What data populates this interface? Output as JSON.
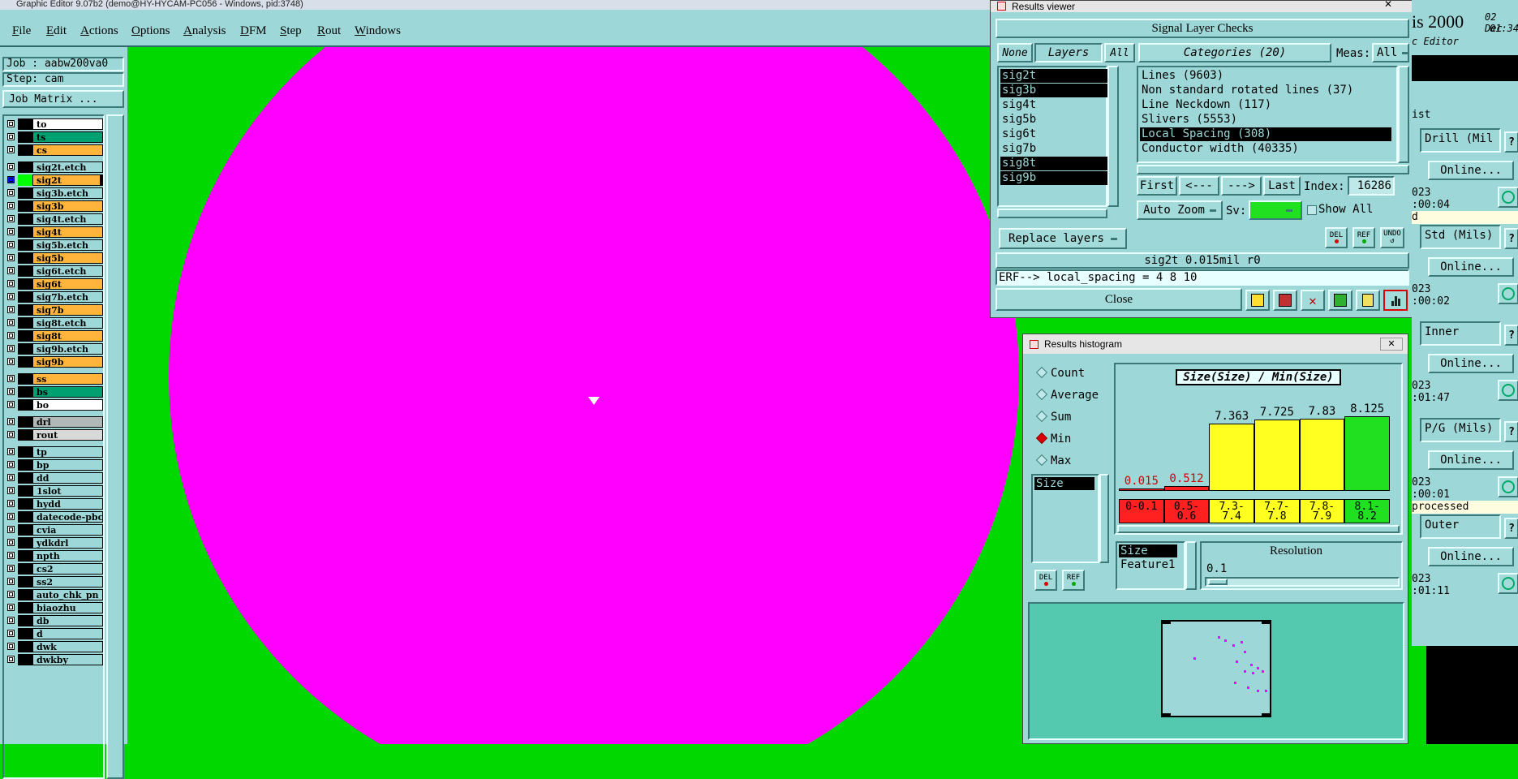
{
  "window_title": "Graphic Editor 9.07b2 (demo@HY-HYCAM-PC056 - Windows, pid:3748)",
  "menu": [
    "File",
    "Edit",
    "Actions",
    "Options",
    "Analysis",
    "DFM",
    "Step",
    "Rout",
    "Windows"
  ],
  "job": {
    "job_label": "Job : aabw200va0",
    "step_label": "Step: cam",
    "matrix_button": "Job Matrix ..."
  },
  "layers": [
    {
      "name": "to",
      "color": "#ffffff"
    },
    {
      "name": "ts",
      "color": "#00a070"
    },
    {
      "name": "cs",
      "color": "#ffb43c"
    },
    {
      "name": "sig2t.etch",
      "color": "#9ed7d7"
    },
    {
      "name": "sig2t",
      "color": "#ffb43c",
      "active": true
    },
    {
      "name": "sig3b.etch",
      "color": "#9ed7d7"
    },
    {
      "name": "sig3b",
      "color": "#ffb43c"
    },
    {
      "name": "sig4t.etch",
      "color": "#9ed7d7"
    },
    {
      "name": "sig4t",
      "color": "#ffb43c"
    },
    {
      "name": "sig5b.etch",
      "color": "#9ed7d7"
    },
    {
      "name": "sig5b",
      "color": "#ffb43c"
    },
    {
      "name": "sig6t.etch",
      "color": "#9ed7d7"
    },
    {
      "name": "sig6t",
      "color": "#ffb43c"
    },
    {
      "name": "sig7b.etch",
      "color": "#9ed7d7"
    },
    {
      "name": "sig7b",
      "color": "#ffb43c"
    },
    {
      "name": "sig8t.etch",
      "color": "#9ed7d7"
    },
    {
      "name": "sig8t",
      "color": "#ffb43c"
    },
    {
      "name": "sig9b.etch",
      "color": "#9ed7d7"
    },
    {
      "name": "sig9b",
      "color": "#ffb43c"
    },
    {
      "name": "ss",
      "color": "#ffb43c"
    },
    {
      "name": "bs",
      "color": "#00a070"
    },
    {
      "name": "bo",
      "color": "#ffffff"
    },
    {
      "name": "drl",
      "color": "#b0b8b8"
    },
    {
      "name": "rout",
      "color": "#d8d8d8"
    },
    {
      "name": "tp",
      "color": "#9ed7d7"
    },
    {
      "name": "bp",
      "color": "#9ed7d7"
    },
    {
      "name": "dd",
      "color": "#9ed7d7"
    },
    {
      "name": "1slot",
      "color": "#9ed7d7"
    },
    {
      "name": "hydd",
      "color": "#9ed7d7"
    },
    {
      "name": "datecode-pbc",
      "color": "#9ed7d7"
    },
    {
      "name": "cvia",
      "color": "#9ed7d7"
    },
    {
      "name": "ydkdrl",
      "color": "#9ed7d7"
    },
    {
      "name": "npth",
      "color": "#9ed7d7"
    },
    {
      "name": "cs2",
      "color": "#9ed7d7"
    },
    {
      "name": "ss2",
      "color": "#9ed7d7"
    },
    {
      "name": "auto_chk_pn",
      "color": "#9ed7d7"
    },
    {
      "name": "biaozhu",
      "color": "#9ed7d7"
    },
    {
      "name": "db",
      "color": "#9ed7d7"
    },
    {
      "name": "d",
      "color": "#9ed7d7"
    },
    {
      "name": "dwk",
      "color": "#9ed7d7"
    },
    {
      "name": "dwkby",
      "color": "#9ed7d7"
    }
  ],
  "results_viewer": {
    "title": "Results viewer",
    "header": "Signal Layer Checks",
    "none_btn": "None",
    "layers_btn": "Layers",
    "all_btn": "All",
    "categories_btn": "Categories (20)",
    "meas_label": "Meas:",
    "meas_value": "All",
    "layer_list": [
      {
        "name": "sig2t",
        "selected": true
      },
      {
        "name": "sig3b",
        "selected": true
      },
      {
        "name": "sig4t",
        "selected": false
      },
      {
        "name": "sig5b",
        "selected": false
      },
      {
        "name": "sig6t",
        "selected": false
      },
      {
        "name": "sig7b",
        "selected": false
      },
      {
        "name": "sig8t",
        "selected": true
      },
      {
        "name": "sig9b",
        "selected": true
      }
    ],
    "categories": [
      {
        "name": "Lines (9603)",
        "selected": false
      },
      {
        "name": "Non standard rotated lines (37)",
        "selected": false
      },
      {
        "name": "Line Neckdown (117)",
        "selected": false
      },
      {
        "name": "Slivers (5553)",
        "selected": false
      },
      {
        "name": "Local Spacing (308)",
        "selected": true
      },
      {
        "name": "Conductor width (40335)",
        "selected": false
      }
    ],
    "first_btn": "First",
    "prev_btn": "<---",
    "next_btn": "--->",
    "last_btn": "Last",
    "index_label": "Index:",
    "index_value": "16286",
    "auto_zoom": "Auto Zoom",
    "sv_label": "Sv:",
    "show_all": "Show All",
    "replace_layers": "Replace layers",
    "del_btn": "DEL",
    "ref_btn": "REF",
    "undo_btn": "UNDO",
    "status_line": "sig2t 0.015mil  r0",
    "erf_line": "ERF--> local_spacing = 4 8 10",
    "close_btn": "Close"
  },
  "histogram": {
    "title": "Results histogram",
    "modes": [
      {
        "label": "Count",
        "selected": false
      },
      {
        "label": "Average",
        "selected": false
      },
      {
        "label": "Sum",
        "selected": false
      },
      {
        "label": "Min",
        "selected": true
      },
      {
        "label": "Max",
        "selected": false
      }
    ],
    "list_item": "Size",
    "chart_title": "Size(Size) / Min(Size)",
    "attr_items": [
      "Size",
      "Feature1"
    ],
    "resolution_label": "Resolution",
    "resolution_value": "0.1",
    "del_btn": "DEL",
    "ref_btn": "REF"
  },
  "chart_data": {
    "type": "bar",
    "title": "Size(Size) / Min(Size)",
    "categories": [
      "0-0.1",
      "0.5-0.6",
      "7.3-7.4",
      "7.7-7.8",
      "7.8-7.9",
      "8.1-8.2"
    ],
    "values": [
      0.015,
      0.512,
      7.363,
      7.725,
      7.83,
      8.125
    ],
    "value_labels": [
      "0.015",
      "0.512",
      "7.363",
      "7.725",
      "7.83",
      "8.125"
    ],
    "colors": [
      "#ff2020",
      "#ff2020",
      "#ffff20",
      "#ffff20",
      "#ffff20",
      "#20e020"
    ],
    "ylim": [
      0,
      9
    ]
  },
  "right_bg": {
    "title_fragment": "is 2000",
    "subtitle": "c Editor",
    "date": "02 Dec",
    "time": "01:34",
    "list_header": "ist",
    "rows": [
      {
        "field": "Drill (Mil",
        "online": "Online...",
        "time": "023\n:00:04",
        "note": "d"
      },
      {
        "field": "Std (Mils)",
        "online": "Online...",
        "time": "023\n:00:02",
        "note": ""
      },
      {
        "field": "Inner",
        "online": "Online...",
        "time": "023\n:01:47",
        "note": ""
      },
      {
        "field": "P/G (Mils)",
        "online": "Online...",
        "time": "023\n:00:01",
        "note": "processed"
      },
      {
        "field": "Outer",
        "online": "Online...",
        "time": "023\n:01:11",
        "note": ""
      }
    ]
  },
  "colors": {
    "panel": "#9ed7d7",
    "canvas": "#00d800",
    "feature": "#ff00ff"
  }
}
